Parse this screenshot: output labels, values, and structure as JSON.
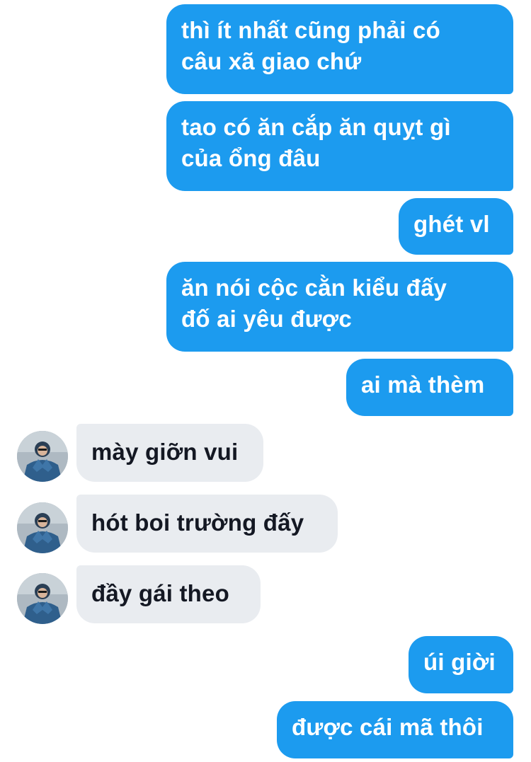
{
  "conversation": {
    "messages": [
      {
        "sender": "me",
        "text": "thì ít nhất cũng phải có\ncâu xã giao chứ"
      },
      {
        "sender": "me",
        "text": "tao có ăn cắp ăn quỵt gì\ncủa ổng đâu"
      },
      {
        "sender": "me",
        "text": "ghét vl"
      },
      {
        "sender": "me",
        "text": "ăn nói cộc cằn kiểu đấy\nđố ai yêu được"
      },
      {
        "sender": "me",
        "text": "ai mà thèm"
      },
      {
        "sender": "them",
        "text": "mày giỡn vui",
        "avatar_icon": "user-avatar-icon"
      },
      {
        "sender": "them",
        "text": "hót boi trường đấy",
        "avatar_icon": "user-avatar-icon"
      },
      {
        "sender": "them",
        "text": "đầy gái theo",
        "avatar_icon": "user-avatar-icon"
      },
      {
        "sender": "me",
        "text": "úi giời"
      },
      {
        "sender": "me",
        "text": "được cái mã thôi"
      }
    ]
  },
  "colors": {
    "outgoing_bubble": "#1c9bef",
    "outgoing_text": "#ffffff",
    "incoming_bubble": "#e9ecf0",
    "incoming_text": "#141823",
    "background": "#ffffff"
  }
}
